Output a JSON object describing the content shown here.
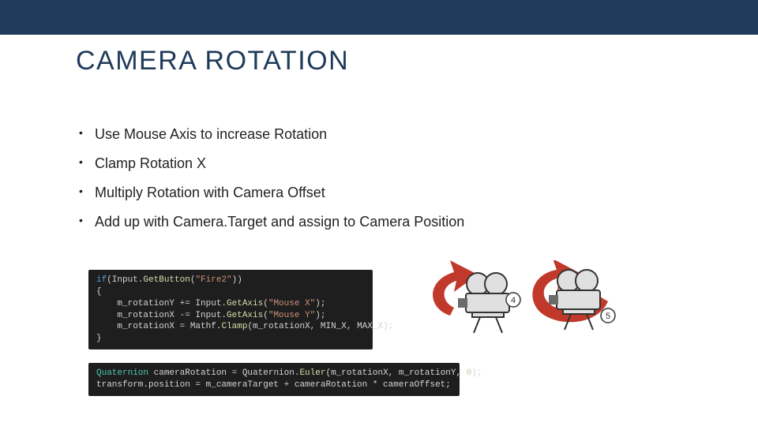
{
  "title": "CAMERA ROTATION",
  "bullets": [
    "Use Mouse Axis to increase Rotation",
    "Clamp Rotation X",
    "Multiply Rotation with Camera Offset",
    "Add up with Camera.Target and assign to Camera Position"
  ],
  "code1": {
    "line1_if": "if",
    "line1_a": "(Input.",
    "line1_fn": "GetButton",
    "line1_b": "(",
    "line1_str": "\"Fire2\"",
    "line1_c": "))",
    "line2": "{",
    "line3_a": "    m_rotationY += Input.",
    "line3_fn": "GetAxis",
    "line3_b": "(",
    "line3_str": "\"Mouse X\"",
    "line3_c": ");",
    "line4_a": "    m_rotationX -= Input.",
    "line4_fn": "GetAxis",
    "line4_b": "(",
    "line4_str": "\"Mouse Y\"",
    "line4_c": ");",
    "line5_a": "    m_rotationX = Mathf.",
    "line5_fn": "Clamp",
    "line5_b": "(m_rotationX, MIN_X, MAX_X);",
    "line6": "}"
  },
  "code2": {
    "line1_cls": "Quaternion",
    "line1_a": " cameraRotation = Quaternion.",
    "line1_fn": "Euler",
    "line1_b": "(m_rotationX, m_rotationY, ",
    "line1_num": "0",
    "line1_c": ");",
    "line2": "transform.position = m_cameraTarget + cameraRotation * cameraOffset;"
  },
  "diagram": {
    "badge1": "4",
    "badge2": "5"
  }
}
